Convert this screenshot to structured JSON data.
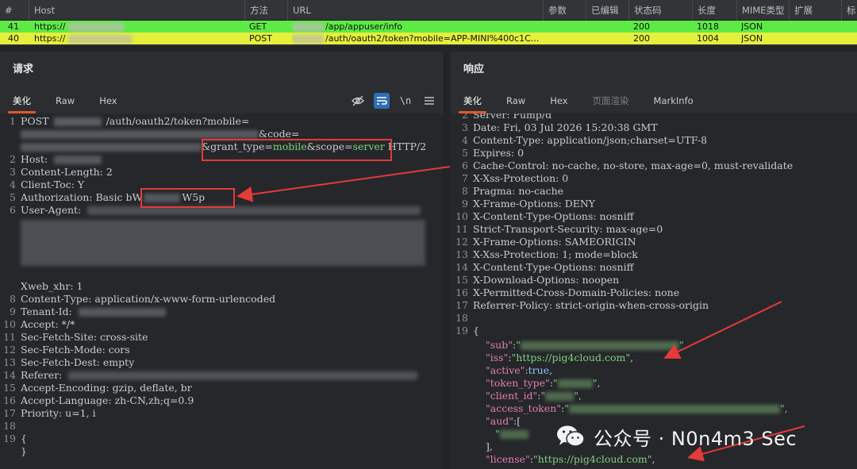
{
  "history": {
    "columns": [
      "#",
      "Host",
      "方法",
      "URL",
      "参数",
      "已编辑",
      "状态码",
      "长度",
      "MIME类型",
      "扩展",
      "标"
    ],
    "rows": [
      {
        "num": "41",
        "host": "https://",
        "method": "GET",
        "url": "/app/appuser/info",
        "status": "200",
        "length": "1018",
        "mime": "JSON",
        "color": "#5dea45"
      },
      {
        "num": "40",
        "host": "https://",
        "method": "POST",
        "url": "/auth/oauth2/token?mobile=APP-MINI%400c1C...",
        "status": "200",
        "length": "1004",
        "mime": "JSON",
        "color": "#e6ef3c"
      }
    ]
  },
  "request": {
    "title": "请求",
    "tabs": [
      "美化",
      "Raw",
      "Hex"
    ],
    "active_tab": "美化",
    "lines": [
      {
        "n": "1",
        "text": "POST",
        "text2": "/auth/oauth2/token?mobile="
      },
      {
        "n": "",
        "text": "&code="
      },
      {
        "n": "",
        "text": "&grant_type=",
        "grant": "mobile",
        "text3": "&scope=",
        "scope": "server",
        "tail": " HTTP/2"
      },
      {
        "n": "2",
        "text": "Host:"
      },
      {
        "n": "3",
        "text": "Content-Length: 2"
      },
      {
        "n": "4",
        "text": "Client-Toc: Y"
      },
      {
        "n": "5",
        "text": "Authorization: Basic ",
        "auth1": "bW",
        "auth2": "W5p"
      },
      {
        "n": "6",
        "text": "User-Agent:"
      },
      {
        "n": "7",
        "text": "Xweb_xhr: 1"
      },
      {
        "n": "8",
        "text": "Content-Type: application/x-www-form-urlencoded"
      },
      {
        "n": "9",
        "text": "Tenant-Id:"
      },
      {
        "n": "10",
        "text": "Accept: */*"
      },
      {
        "n": "11",
        "text": "Sec-Fetch-Site: cross-site"
      },
      {
        "n": "12",
        "text": "Sec-Fetch-Mode: cors"
      },
      {
        "n": "13",
        "text": "Sec-Fetch-Dest: empty"
      },
      {
        "n": "14",
        "text": "Referer:"
      },
      {
        "n": "15",
        "text": "Accept-Encoding: gzip, deflate, br"
      },
      {
        "n": "16",
        "text": "Accept-Language: zh-CN,zh;q=0.9"
      },
      {
        "n": "17",
        "text": "Priority: u=1, i"
      },
      {
        "n": "18",
        "text": ""
      },
      {
        "n": "19",
        "text": "{"
      },
      {
        "n": "",
        "text": "}"
      }
    ]
  },
  "response": {
    "title": "响应",
    "tabs": [
      "美化",
      "Raw",
      "Hex",
      "页面渲染",
      "MarkInfo"
    ],
    "active_tab": "美化",
    "lines": [
      {
        "n": "2",
        "text": "Server: Pump/d"
      },
      {
        "n": "3",
        "text": "Date: Fri, 03 Jul 2026 15:20:38 GMT"
      },
      {
        "n": "4",
        "text": "Content-Type: application/json;charset=UTF-8"
      },
      {
        "n": "5",
        "text": "Expires: 0"
      },
      {
        "n": "6",
        "text": "Cache-Control: no-cache, no-store, max-age=0, must-revalidate"
      },
      {
        "n": "7",
        "text": "X-Xss-Protection: 0"
      },
      {
        "n": "8",
        "text": "Pragma: no-cache"
      },
      {
        "n": "9",
        "text": "X-Frame-Options: DENY"
      },
      {
        "n": "10",
        "text": "X-Content-Type-Options: nosniff"
      },
      {
        "n": "11",
        "text": "Strict-Transport-Security: max-age=0"
      },
      {
        "n": "12",
        "text": "X-Frame-Options: SAMEORIGIN"
      },
      {
        "n": "13",
        "text": "X-Xss-Protection: 1; mode=block"
      },
      {
        "n": "14",
        "text": "X-Content-Type-Options: nosniff"
      },
      {
        "n": "15",
        "text": "X-Download-Options: noopen"
      },
      {
        "n": "16",
        "text": "X-Permitted-Cross-Domain-Policies: none"
      },
      {
        "n": "17",
        "text": "Referrer-Policy: strict-origin-when-cross-origin"
      },
      {
        "n": "18",
        "text": ""
      },
      {
        "n": "19",
        "text": "{"
      }
    ],
    "json": [
      {
        "key": "\"sub\"",
        "sep": ":",
        "value": "\"",
        "tail": "\","
      },
      {
        "key": "\"iss\"",
        "sep": ":",
        "value": "\"https://pig4cloud.com\"",
        "tail": ","
      },
      {
        "key": "\"active\"",
        "sep": ":",
        "value": "true",
        "tail": ","
      },
      {
        "key": "\"token_type\"",
        "sep": ":",
        "value": "\"",
        "tail": "\","
      },
      {
        "key": "\"client_id\"",
        "sep": ":",
        "value": "\"",
        "tail": "\","
      },
      {
        "key": "\"access_token\"",
        "sep": ":",
        "value": "\"",
        "tail": "\","
      },
      {
        "key": "\"aud\"",
        "sep": ":",
        "value": "[",
        "tail": ""
      },
      {
        "key": "",
        "sep": "",
        "value": "\"",
        "tail": ""
      },
      {
        "key": "",
        "sep": "",
        "value": "],",
        "tail": ""
      },
      {
        "key": "\"license\"",
        "sep": ":",
        "value": "\"https://pig4cloud.com\"",
        "tail": ","
      }
    ]
  },
  "watermark": {
    "text": "公众号 · N0n4m3 Sec"
  },
  "colors": {
    "accent": "#e4572e",
    "annotation": "#e53a3a",
    "row_selected": "#e6ef3c",
    "row_normal": "#5dea45"
  }
}
